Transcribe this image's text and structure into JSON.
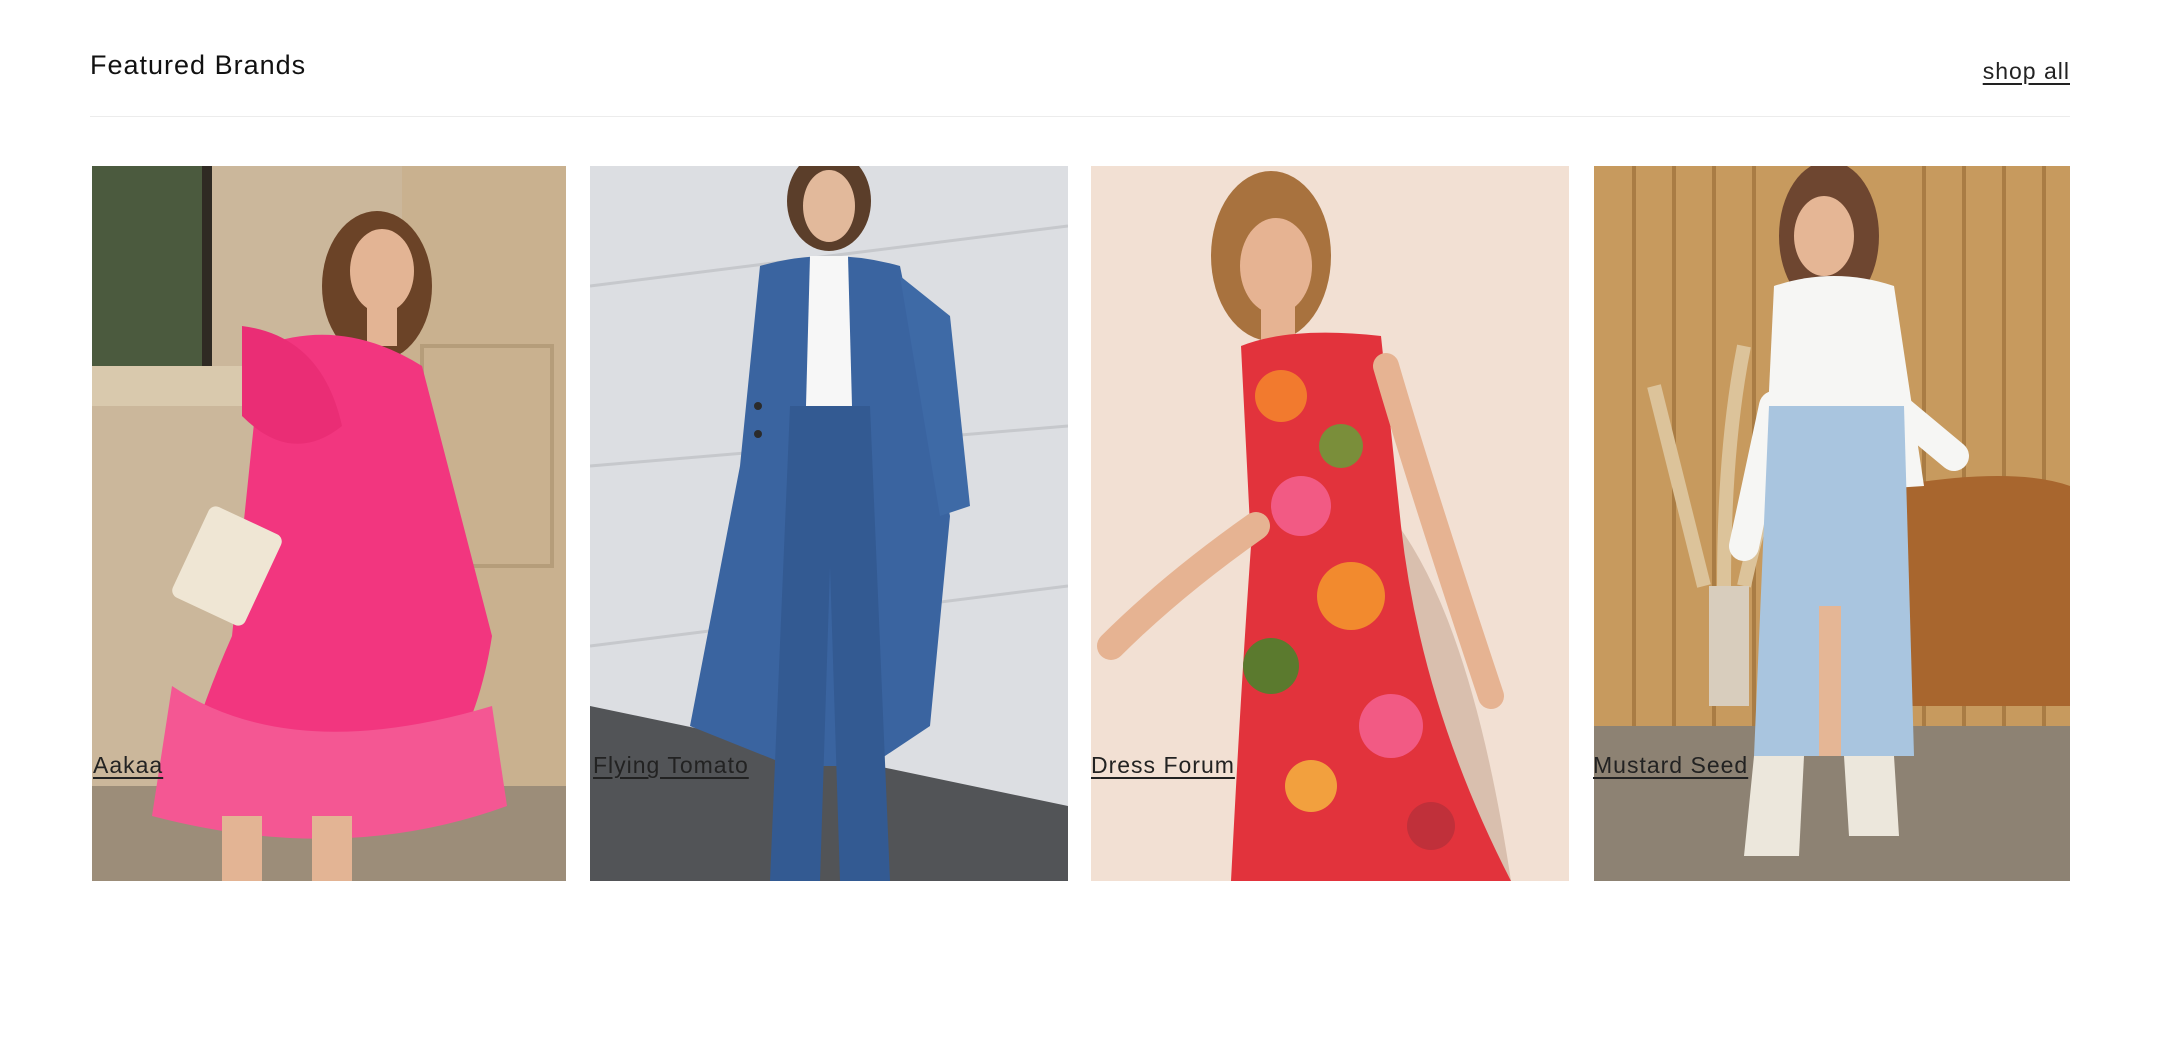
{
  "section": {
    "title": "Featured Brands",
    "shop_all_label": "shop all"
  },
  "brands": [
    {
      "name": "Aakaa",
      "image_desc_icon": "photo-pink-ruffle-dress"
    },
    {
      "name": "Flying Tomato",
      "image_desc_icon": "photo-denim-coat-set"
    },
    {
      "name": "Dress Forum",
      "image_desc_icon": "photo-floral-maxi-dress"
    },
    {
      "name": "Mustard Seed",
      "image_desc_icon": "photo-denim-midi-skirt"
    }
  ],
  "colors": {
    "text": "#111111",
    "divider": "#ececec",
    "pink_dress": "#f2367f",
    "denim": "#3a64a0",
    "floral_red": "#e2333c",
    "light_denim": "#a9c5df"
  }
}
